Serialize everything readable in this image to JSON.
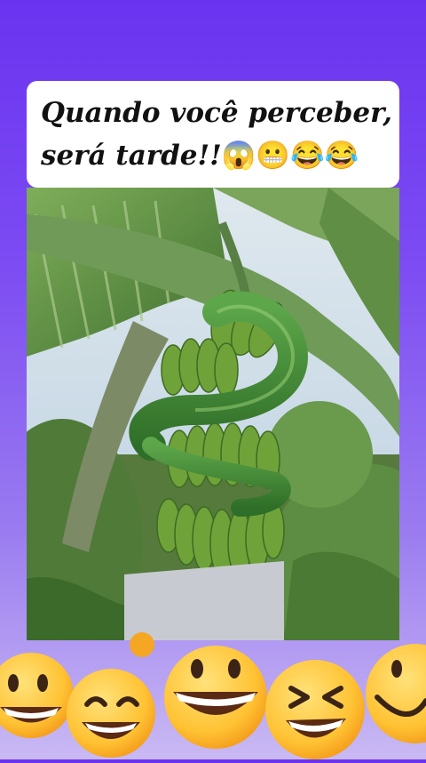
{
  "caption": {
    "line1": "Quando você perceber,",
    "line2": "será tarde!!",
    "emojis": [
      "😱",
      "😬",
      "😂",
      "😂"
    ]
  },
  "colors": {
    "background_top": "#6a33f0",
    "background_bottom": "#c9b9f3",
    "card": "#ffffff",
    "snake": "#3f8a35",
    "banana": "#6fa33a",
    "emoji_face": "#ffc83a"
  },
  "photo": {
    "subject": "green-snake-coiled-around-banana-bunch"
  },
  "decorations": {
    "bottom_emojis": [
      "grinning-face",
      "smiling-eyes-face",
      "big-grin-face",
      "squinting-laugh-face",
      "smile-face"
    ]
  }
}
